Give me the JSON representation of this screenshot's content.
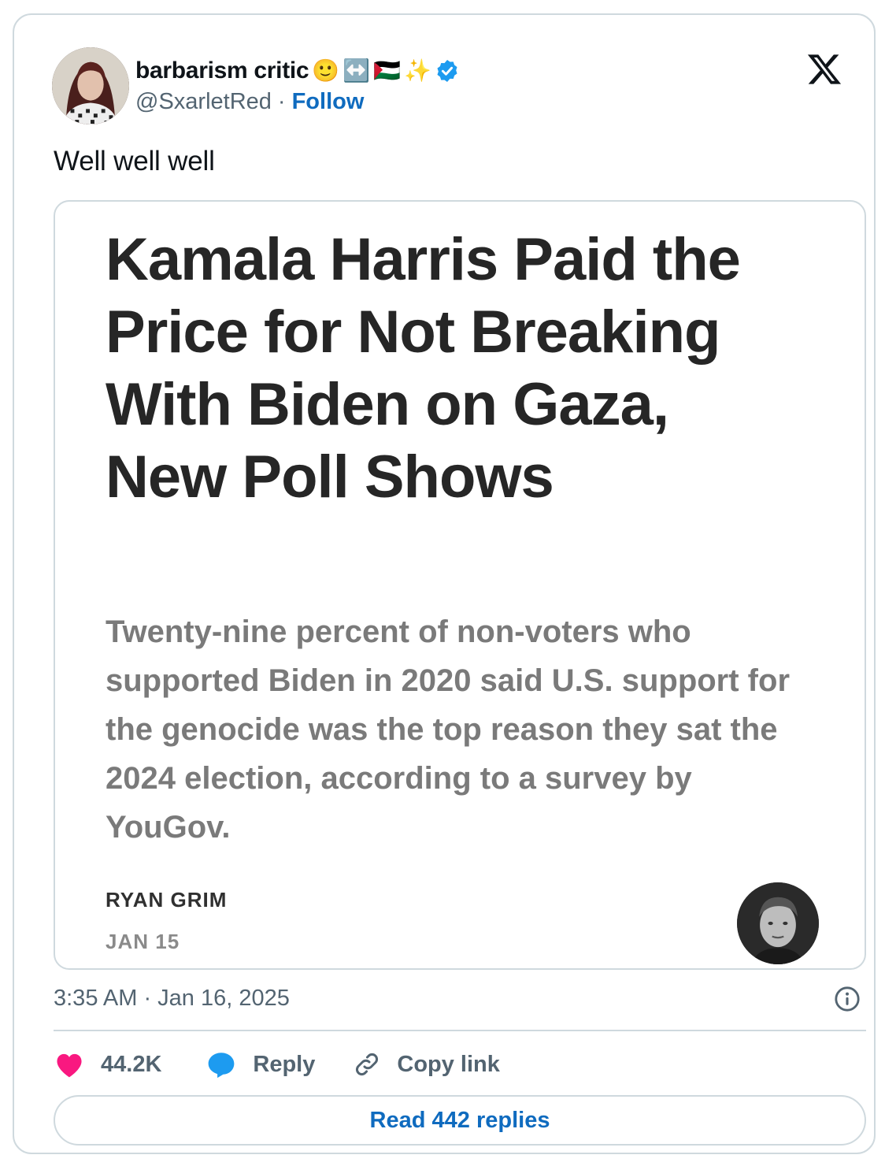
{
  "user": {
    "display_name": "barbarism critic",
    "name_emojis": [
      "🙂",
      "↔️",
      "🇵🇸",
      "✨"
    ],
    "verified_icon": "verified-badge-icon",
    "handle": "@SxarletRed",
    "separator": "·",
    "follow_label": "Follow"
  },
  "platform_icon": "x-logo-icon",
  "tweet": {
    "text": "Well well well",
    "timestamp": "3:35 AM · Jan 16, 2025"
  },
  "article": {
    "headline": "Kamala Harris Paid the Price for Not Breaking With Biden on Gaza, New Poll Shows",
    "subtitle": "Twenty-nine percent of non-voters who supported Biden in 2020 said U.S. support for the genocide was the top reason they sat the 2024 election, according to a survey by YouGov.",
    "author": "RYAN GRIM",
    "date": "JAN 15"
  },
  "actions": {
    "likes": "44.2K",
    "reply_label": "Reply",
    "copy_label": "Copy link",
    "read_replies_label": "Read 442 replies"
  },
  "colors": {
    "link": "#0f6bbf",
    "like": "#f91880",
    "reply": "#1d9bf0",
    "verified": "#1d9bf0",
    "muted": "#536471",
    "border": "#cfd9de"
  }
}
